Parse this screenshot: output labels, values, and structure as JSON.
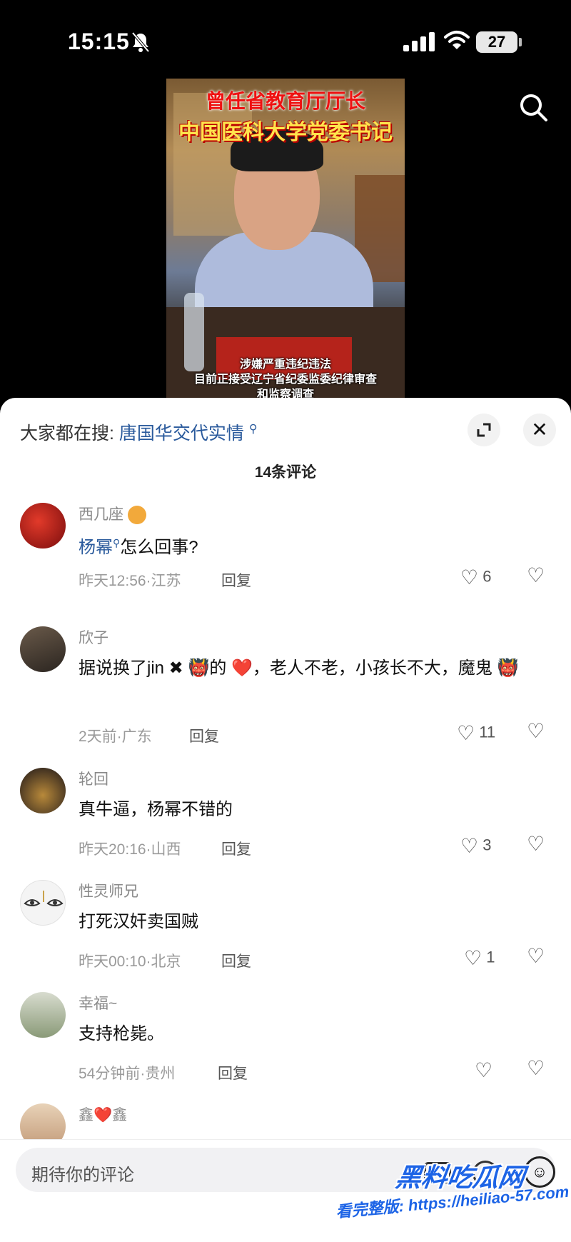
{
  "status_bar": {
    "time": "15:15",
    "battery": "27"
  },
  "video": {
    "title_line1": "曾任省教育厅厅长",
    "title_line2": "中国医科大学党委书记",
    "caption_line1": "涉嫌严重违纪违法",
    "caption_line2": "目前正接受辽宁省纪委监委纪律审查",
    "caption_line3": "和监察调查"
  },
  "sheet": {
    "hot_search_label": "大家都在搜:",
    "hot_search_query": "唐国华交代实情",
    "comment_count": "14条评论"
  },
  "comments": [
    {
      "user": "西几座",
      "text_mention": "杨幂",
      "text": "怎么回事?",
      "time_loc": "昨天12:56·江苏",
      "reply": "回复",
      "likes": "6"
    },
    {
      "user": "欣子",
      "text": "据说换了jin ✖ 👹的 ❤️，老人不老，小孩长不大，魔鬼 👹",
      "time_loc": "2天前·广东",
      "reply": "回复",
      "likes": "11"
    },
    {
      "user": "轮回",
      "text": "真牛逼，杨幂不错的",
      "time_loc": "昨天20:16·山西",
      "reply": "回复",
      "likes": "3"
    },
    {
      "user": "性灵师兄",
      "text": "打死汉奸卖国贼",
      "time_loc": "昨天00:10·北京",
      "reply": "回复",
      "likes": "1"
    },
    {
      "user": "幸福~",
      "text": "支持枪毙。",
      "time_loc": "54分钟前·贵州",
      "reply": "回复",
      "likes": ""
    },
    {
      "user": "鑫❤️鑫"
    }
  ],
  "input": {
    "placeholder": "期待你的评论"
  },
  "watermark": {
    "logo": "黑料吃瓜网",
    "url": "看完整版: https://heiliao-57.com"
  },
  "colors": {
    "link": "#2a5a9c",
    "watermark": "#1d64e6"
  }
}
